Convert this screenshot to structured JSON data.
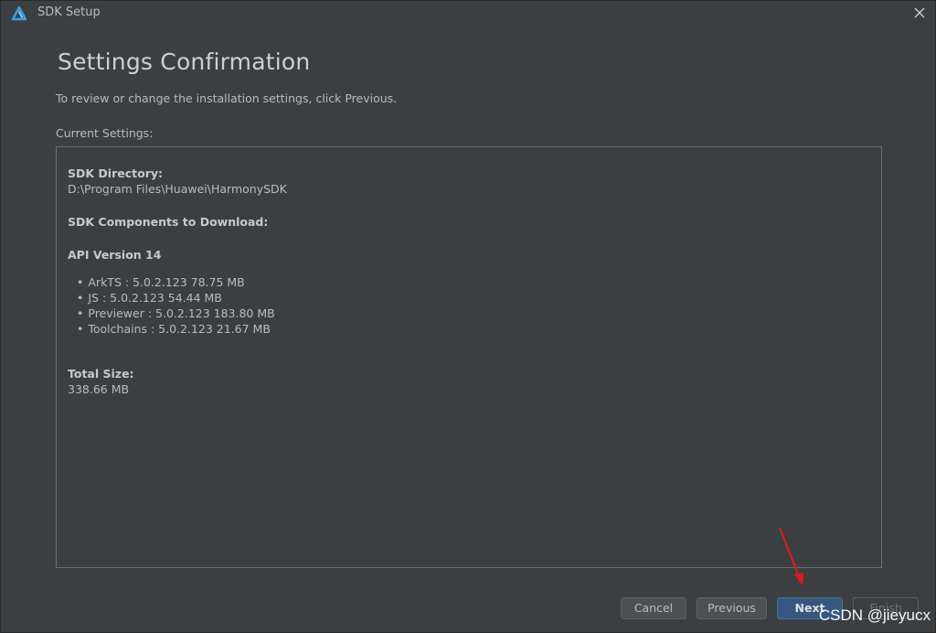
{
  "window": {
    "title": "SDK Setup",
    "icon": "harmony-logo-icon",
    "close_icon": "close-icon"
  },
  "page": {
    "title": "Settings Confirmation",
    "instruction": "To review or change the installation settings, click Previous.",
    "current_settings_label": "Current Settings:"
  },
  "settings": {
    "sdk_directory_label": "SDK Directory:",
    "sdk_directory_value": "D:\\Program Files\\Huawei\\HarmonySDK",
    "components_label": "SDK Components to Download:",
    "api_version": "API Version 14",
    "components": [
      {
        "text": "ArkTS : 5.0.2.123  78.75 MB"
      },
      {
        "text": "JS : 5.0.2.123  54.44 MB"
      },
      {
        "text": "Previewer : 5.0.2.123  183.80 MB"
      },
      {
        "text": "Toolchains : 5.0.2.123  21.67 MB"
      }
    ],
    "total_size_label": "Total Size:",
    "total_size_value": "338.66 MB"
  },
  "buttons": {
    "cancel": "Cancel",
    "previous": "Previous",
    "next": "Next",
    "finish": "Finish"
  },
  "watermark": "CSDN @jieyucx",
  "colors": {
    "background": "#3c3f41",
    "primary_button": "#365880",
    "annotation_arrow": "#e0191e"
  }
}
